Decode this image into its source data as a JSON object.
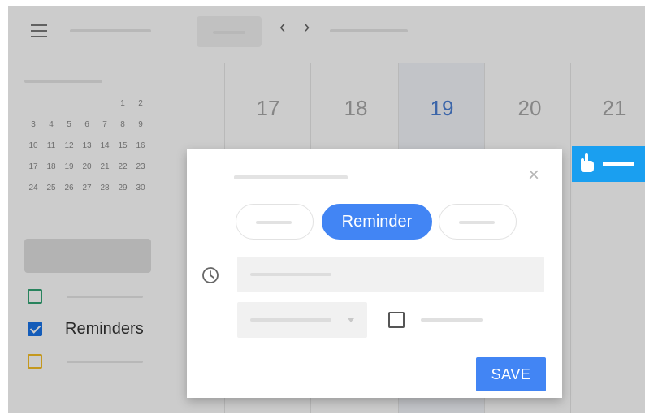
{
  "week": {
    "days": [
      "17",
      "18",
      "19",
      "20",
      "21"
    ],
    "today_index": 2
  },
  "mini_calendar": {
    "rows": [
      [
        "",
        "",
        "",
        "",
        "",
        "1",
        "2"
      ],
      [
        "3",
        "4",
        "5",
        "6",
        "7",
        "8",
        "9"
      ],
      [
        "10",
        "11",
        "12",
        "13",
        "14",
        "15",
        "16"
      ],
      [
        "17",
        "18",
        "19",
        "20",
        "21",
        "22",
        "23"
      ],
      [
        "24",
        "25",
        "26",
        "27",
        "28",
        "29",
        "30"
      ]
    ]
  },
  "calendars": [
    {
      "label": "",
      "color": "#33a475",
      "checked": false
    },
    {
      "label": "Reminders",
      "color": "#1a73e8",
      "checked": true
    },
    {
      "label": "",
      "color": "#f6bf26",
      "checked": false
    }
  ],
  "dialog": {
    "tabs": [
      "",
      "Reminder",
      ""
    ],
    "active_tab": 1,
    "save_label": "SAVE"
  },
  "colors": {
    "accent": "#4285f4",
    "drag_indicator": "#1a9ff0"
  }
}
